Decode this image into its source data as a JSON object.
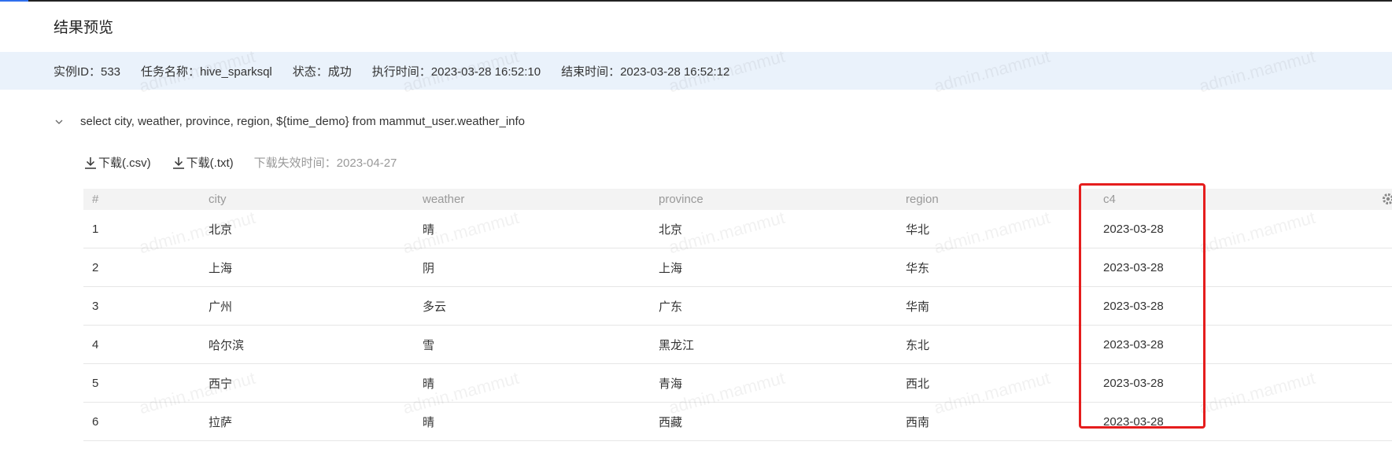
{
  "page": {
    "title": "结果预览"
  },
  "info": {
    "instance_id": "实例ID：533",
    "task_name": "任务名称：hive_sparksql",
    "status": "状态：成功",
    "exec_time": "执行时间：2023-03-28 16:52:10",
    "end_time": "结束时间：2023-03-28 16:52:12"
  },
  "query": {
    "sql": "select city, weather, province, region, ${time_demo} from mammut_user.weather_info"
  },
  "toolbar": {
    "download_csv": "下载(.csv)",
    "download_txt": "下载(.txt)",
    "expire": "下载失效时间：2023-04-27"
  },
  "table": {
    "columns": [
      "#",
      "city",
      "weather",
      "province",
      "region",
      "c4"
    ],
    "rows": [
      [
        "1",
        "北京",
        "晴",
        "北京",
        "华北",
        "2023-03-28"
      ],
      [
        "2",
        "上海",
        "阴",
        "上海",
        "华东",
        "2023-03-28"
      ],
      [
        "3",
        "广州",
        "多云",
        "广东",
        "华南",
        "2023-03-28"
      ],
      [
        "4",
        "哈尔滨",
        "雪",
        "黑龙江",
        "东北",
        "2023-03-28"
      ],
      [
        "5",
        "西宁",
        "晴",
        "青海",
        "西北",
        "2023-03-28"
      ],
      [
        "6",
        "拉萨",
        "晴",
        "西藏",
        "西南",
        "2023-03-28"
      ]
    ]
  },
  "watermark": {
    "text": "admin.mammut"
  },
  "colors": {
    "info_bg": "#eaf2fb",
    "highlight": "#e51d1d",
    "accent": "#2f6fed"
  }
}
